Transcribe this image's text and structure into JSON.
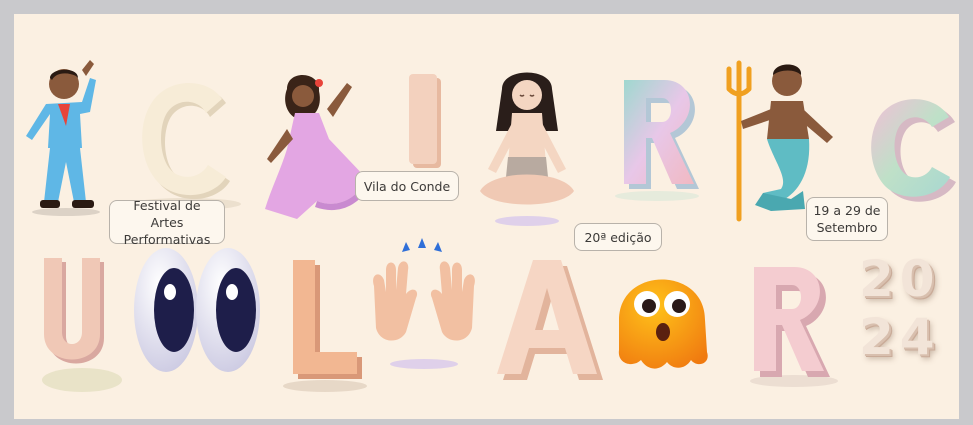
{
  "title_letters": {
    "row1": [
      "C",
      "I",
      "R",
      "C"
    ],
    "row2": [
      "U",
      "L",
      "A",
      "R"
    ]
  },
  "labels": {
    "festival": "Festival de Artes Performativas",
    "location": "Vila do Conde",
    "edition": "20ª edição",
    "dates": "19 a 29 de Setembro"
  },
  "year": {
    "top": "20",
    "bottom": "24"
  },
  "icons": [
    "man-dancing-icon",
    "woman-dancing-icon",
    "person-in-lotus-position-icon",
    "merman-icon",
    "eyes-icon",
    "raising-hands-icon",
    "face-with-open-mouth-blob-icon"
  ],
  "colors": {
    "background": "#fbf0e2",
    "frame": "#c9c9cc",
    "bubble_border": "#b8b2aa"
  }
}
